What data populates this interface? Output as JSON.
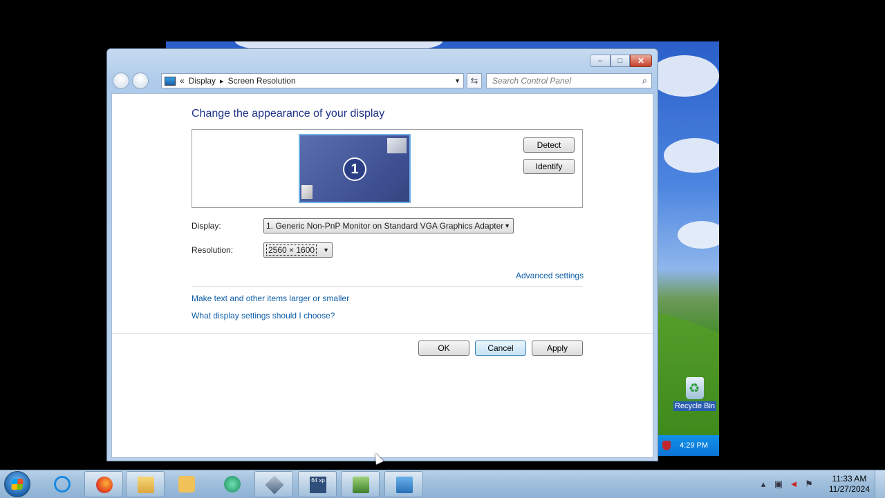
{
  "window": {
    "breadcrumb": {
      "chevrons": "«",
      "item1": "Display",
      "item2": "Screen Resolution"
    },
    "search_placeholder": "Search Control Panel",
    "caption": {
      "minimize": "–",
      "maximize": "□",
      "close": "✕"
    }
  },
  "content": {
    "title": "Change the appearance of your display",
    "monitor_number": "1",
    "detect_label": "Detect",
    "identify_label": "Identify",
    "display_label": "Display:",
    "display_value": "1. Generic Non-PnP Monitor on Standard VGA Graphics Adapter",
    "resolution_label": "Resolution:",
    "resolution_value": "2560 × 1600",
    "advanced_link": "Advanced settings",
    "link_text_size": "Make text and other items larger or smaller",
    "link_which_settings": "What display settings should I choose?",
    "ok_label": "OK",
    "cancel_label": "Cancel",
    "apply_label": "Apply"
  },
  "vm": {
    "recycle_bin_label": "Recycle Bin",
    "clock": "4:29 PM"
  },
  "taskbar": {
    "time": "11:33 AM",
    "date": "11/27/2024",
    "xp_badge": "64 xp"
  },
  "colors": {
    "title_blue": "#1e3287",
    "link_blue": "#0e5ea8"
  }
}
